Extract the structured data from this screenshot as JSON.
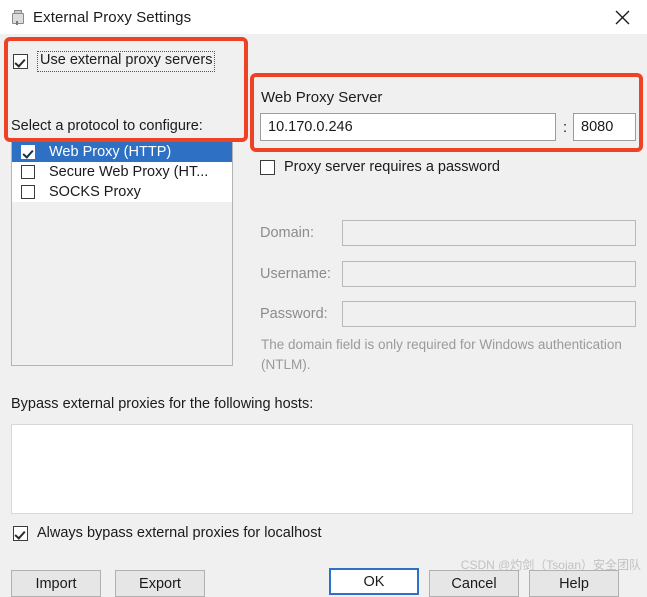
{
  "titlebar": {
    "title": "External Proxy Settings",
    "icon": "plug-icon",
    "close_icon": "close-icon"
  },
  "use_external_proxy": {
    "label": "Use external proxy servers",
    "checked": true
  },
  "protocol_section": {
    "label": "Select a protocol to configure:",
    "items": [
      {
        "label": "Web Proxy (HTTP)",
        "checked": true,
        "selected": true
      },
      {
        "label": "Secure Web Proxy (HT...",
        "checked": false,
        "selected": false
      },
      {
        "label": "SOCKS Proxy",
        "checked": false,
        "selected": false
      }
    ]
  },
  "web_proxy_server": {
    "title": "Web Proxy Server",
    "host": "10.170.0.246",
    "host_placeholder": "",
    "separator": ":",
    "port": "8080",
    "port_placeholder": ""
  },
  "password_section": {
    "requires_password_label": "Proxy server requires a password",
    "requires_password_checked": false,
    "fields": [
      {
        "label": "Domain:",
        "value": "",
        "placeholder": ""
      },
      {
        "label": "Username:",
        "value": "",
        "placeholder": ""
      },
      {
        "label": "Password:",
        "value": "",
        "placeholder": ""
      }
    ],
    "hint": "The domain field is only required for Windows authentication (NTLM)."
  },
  "bypass": {
    "label": "Bypass external proxies for the following hosts:",
    "value": "",
    "placeholder": ""
  },
  "always_bypass": {
    "label": "Always bypass external proxies for localhost",
    "checked": true
  },
  "buttons": {
    "import": "Import",
    "export": "Export",
    "ok": "OK",
    "cancel": "Cancel",
    "help": "Help"
  },
  "watermark": "CSDN @灼剑（Tsojan）安全团队",
  "colors": {
    "selection_blue": "#2d70c4",
    "annotation_red": "#ef4123",
    "dialog_background": "#f0f0f0",
    "field_background": "#ffffff",
    "disabled_text": "#8c8c8c"
  }
}
